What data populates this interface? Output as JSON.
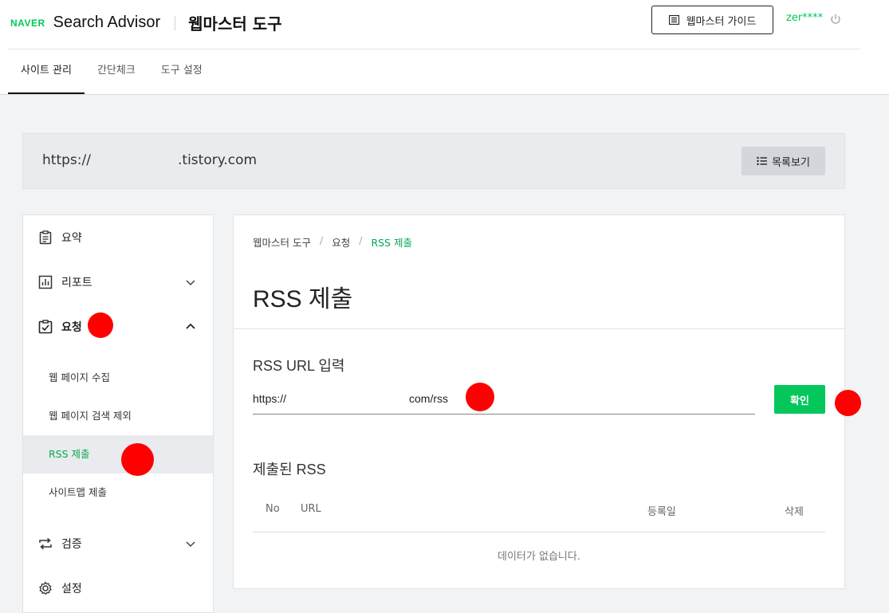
{
  "header": {
    "brand": "NAVER",
    "product": "Search Advisor",
    "tool_title": "웹마스터 도구",
    "guide_label": "웹마스터 가이드",
    "user": "zer****"
  },
  "tabs": [
    {
      "label": "사이트 관리",
      "active": true
    },
    {
      "label": "간단체크",
      "active": false
    },
    {
      "label": "도구 설정",
      "active": false
    }
  ],
  "site": {
    "url_prefix": "https://",
    "url_suffix": ".tistory.com",
    "list_label": "목록보기"
  },
  "sidebar": {
    "items": [
      {
        "label": "요약"
      },
      {
        "label": "리포트"
      },
      {
        "label": "요청"
      },
      {
        "label": "검증"
      },
      {
        "label": "설정"
      }
    ],
    "subitems": [
      {
        "label": "웹 페이지 수집"
      },
      {
        "label": "웹 페이지 검색 제외"
      },
      {
        "label": "RSS 제출",
        "active": true
      },
      {
        "label": "사이트맵 제출"
      }
    ]
  },
  "main": {
    "breadcrumb": [
      "웹마스터 도구",
      "요청",
      "RSS 제출"
    ],
    "title": "RSS 제출",
    "input_section": "RSS URL 입력",
    "input_value_prefix": "https://",
    "input_value_suffix": "com/rss",
    "confirm_label": "확인",
    "submitted_title": "제출된 RSS",
    "table_headers": [
      "No",
      "URL",
      "등록일",
      "삭제"
    ],
    "empty_text": "데이터가 없습니다."
  },
  "colors": {
    "accent": "#03c75a",
    "marker": "#ff0000"
  }
}
